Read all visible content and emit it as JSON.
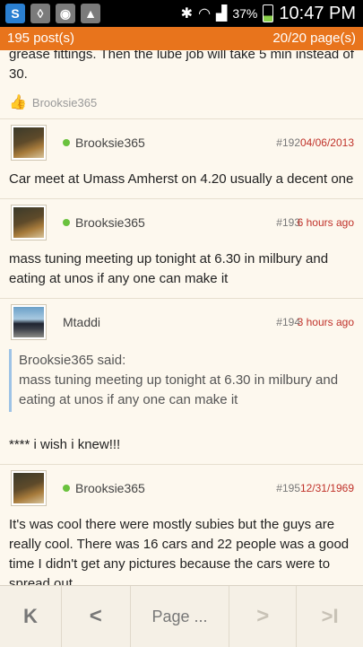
{
  "status_bar": {
    "battery": "37%",
    "time": "10:47 PM"
  },
  "thread_bar": {
    "posts": "195 post(s)",
    "pages": "20/20 page(s)"
  },
  "posts": [
    {
      "text_partial": "grease fittings. Then the lube job will take 5 min instead of 30.",
      "liked_by": "Brooksie365"
    },
    {
      "author": "Brooksie365",
      "number": "#192",
      "date": "04/06/2013",
      "text": "Car meet at Umass Amherst on 4.20 usually a decent one"
    },
    {
      "author": "Brooksie365",
      "number": "#193",
      "date": "6 hours ago",
      "text": "mass tuning meeting up tonight at 6.30 in milbury and eating at unos if any one can make it"
    },
    {
      "author": "Mtaddi",
      "number": "#194",
      "date": "3 hours ago",
      "quote_author": "Brooksie365 said:",
      "quote_text": "mass tuning meeting up tonight at 6.30 in milbury and eating at unos if any one can make it",
      "text": "**** i wish i knew!!!"
    },
    {
      "author": "Brooksie365",
      "number": "#195",
      "date": "12/31/1969",
      "text": "It's was cool there were mostly subies but the guys are really cool. There was 16 cars and 22 people was a good time I didn't get any pictures because the cars were to spread out"
    }
  ],
  "pager": {
    "first": "K",
    "prev": "<",
    "page_label": "Page ...",
    "next": ">",
    "last": ">I"
  }
}
